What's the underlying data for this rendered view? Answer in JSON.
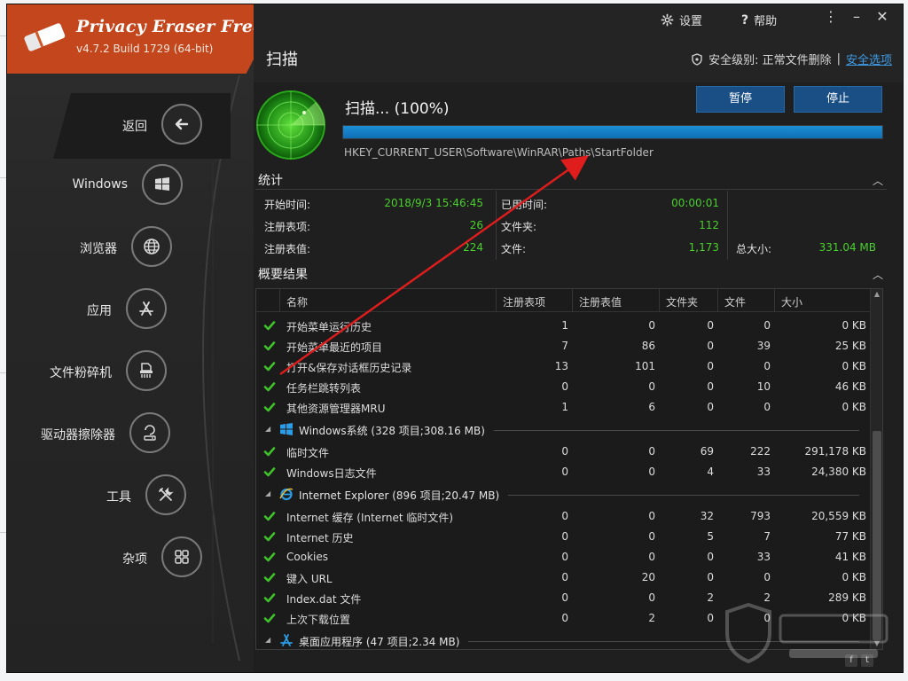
{
  "app": {
    "title": "Privacy Eraser Free",
    "version": "v4.7.2 Build 1729 (64-bit)"
  },
  "header": {
    "page_title": "扫描",
    "settings_label": "设置",
    "help_label": "帮助",
    "security_label": "安全级别: 正常文件删除",
    "security_link": "安全选项",
    "separator": "|"
  },
  "window_buttons": {
    "menu": "⋮",
    "minimize": "–",
    "close": "✕"
  },
  "sidebar": {
    "items": [
      {
        "label": "返回",
        "icon": "back-arrow-icon"
      },
      {
        "label": "Windows",
        "icon": "windows-icon"
      },
      {
        "label": "浏览器",
        "icon": "globe-icon"
      },
      {
        "label": "应用",
        "icon": "app-store-icon"
      },
      {
        "label": "文件粉碎机",
        "icon": "shredder-icon"
      },
      {
        "label": "驱动器擦除器",
        "icon": "drive-wiper-icon"
      },
      {
        "label": "工具",
        "icon": "tools-icon"
      },
      {
        "label": "杂项",
        "icon": "misc-grid-icon"
      }
    ]
  },
  "scan": {
    "status": "扫描... (100%)",
    "progress_percent": 100,
    "current_path": "HKEY_CURRENT_USER\\Software\\WinRAR\\Paths\\StartFolder",
    "pause_label": "暂停",
    "stop_label": "停止"
  },
  "stats": {
    "section_title": "统计",
    "collapse_glyph": "︿",
    "start_time_label": "开始时间:",
    "start_time_value": "2018/9/3 15:46:45",
    "elapsed_label": "已用时间:",
    "elapsed_value": "00:00:01",
    "reg_items_label": "注册表项:",
    "reg_items_value": "26",
    "folders_label": "文件夹:",
    "folders_value": "112",
    "reg_values_label": "注册表值:",
    "reg_values_value": "224",
    "files_label": "文件:",
    "files_value": "1,173",
    "total_size_label": "总大小:",
    "total_size_value": "331.04 MB"
  },
  "results": {
    "section_title": "概要结果",
    "collapse_glyph": "︿",
    "columns": [
      "名称",
      "注册表项",
      "注册表值",
      "文件夹",
      "文件",
      "大小"
    ],
    "rows": [
      {
        "kind": "row",
        "name": "开始菜单运行历史",
        "reg_items": "1",
        "reg_values": "0",
        "folders": "0",
        "files": "0",
        "size": "0 KB"
      },
      {
        "kind": "row",
        "name": "开始菜单最近的项目",
        "reg_items": "7",
        "reg_values": "86",
        "folders": "0",
        "files": "39",
        "size": "25 KB"
      },
      {
        "kind": "row",
        "name": "打开&保存对话框历史记录",
        "reg_items": "13",
        "reg_values": "101",
        "folders": "0",
        "files": "0",
        "size": "0 KB"
      },
      {
        "kind": "row",
        "name": "任务栏跳转列表",
        "reg_items": "0",
        "reg_values": "0",
        "folders": "0",
        "files": "10",
        "size": "46 KB"
      },
      {
        "kind": "row",
        "name": "其他资源管理器MRU",
        "reg_items": "1",
        "reg_values": "6",
        "folders": "0",
        "files": "0",
        "size": "0 KB"
      },
      {
        "kind": "group",
        "name": "Windows系统 (328 项目;308.16 MB)",
        "icon": "windows-icon"
      },
      {
        "kind": "row",
        "name": "临时文件",
        "reg_items": "0",
        "reg_values": "0",
        "folders": "69",
        "files": "222",
        "size": "291,178 KB"
      },
      {
        "kind": "row",
        "name": "Windows日志文件",
        "reg_items": "0",
        "reg_values": "0",
        "folders": "4",
        "files": "33",
        "size": "24,380 KB"
      },
      {
        "kind": "group",
        "name": "Internet Explorer (896 项目;20.47 MB)",
        "icon": "internet-explorer-icon"
      },
      {
        "kind": "row",
        "name": "Internet 缓存 (Internet 临时文件)",
        "reg_items": "0",
        "reg_values": "0",
        "folders": "32",
        "files": "793",
        "size": "20,559 KB"
      },
      {
        "kind": "row",
        "name": "Internet 历史",
        "reg_items": "0",
        "reg_values": "0",
        "folders": "5",
        "files": "7",
        "size": "77 KB"
      },
      {
        "kind": "row",
        "name": "Cookies",
        "reg_items": "0",
        "reg_values": "0",
        "folders": "0",
        "files": "33",
        "size": "41 KB"
      },
      {
        "kind": "row",
        "name": "键入 URL",
        "reg_items": "0",
        "reg_values": "20",
        "folders": "0",
        "files": "0",
        "size": "0 KB"
      },
      {
        "kind": "row",
        "name": "Index.dat 文件",
        "reg_items": "0",
        "reg_values": "0",
        "folders": "2",
        "files": "2",
        "size": "289 KB"
      },
      {
        "kind": "row",
        "name": "上次下载位置",
        "reg_items": "0",
        "reg_values": "2",
        "folders": "0",
        "files": "0",
        "size": "0 KB"
      },
      {
        "kind": "group",
        "name": "桌面应用程序 (47 项目;2.34 MB)",
        "icon": "app-store-icon"
      }
    ]
  },
  "social": {
    "facebook": "f",
    "twitter": "t"
  },
  "colors": {
    "brand": "#c3461c",
    "accent_green": "#4ad02c",
    "progress_blue": "#1c8fd6",
    "button_blue": "#1a4f86",
    "link_blue": "#3f9be6",
    "annotation_red": "#e01d1d"
  }
}
